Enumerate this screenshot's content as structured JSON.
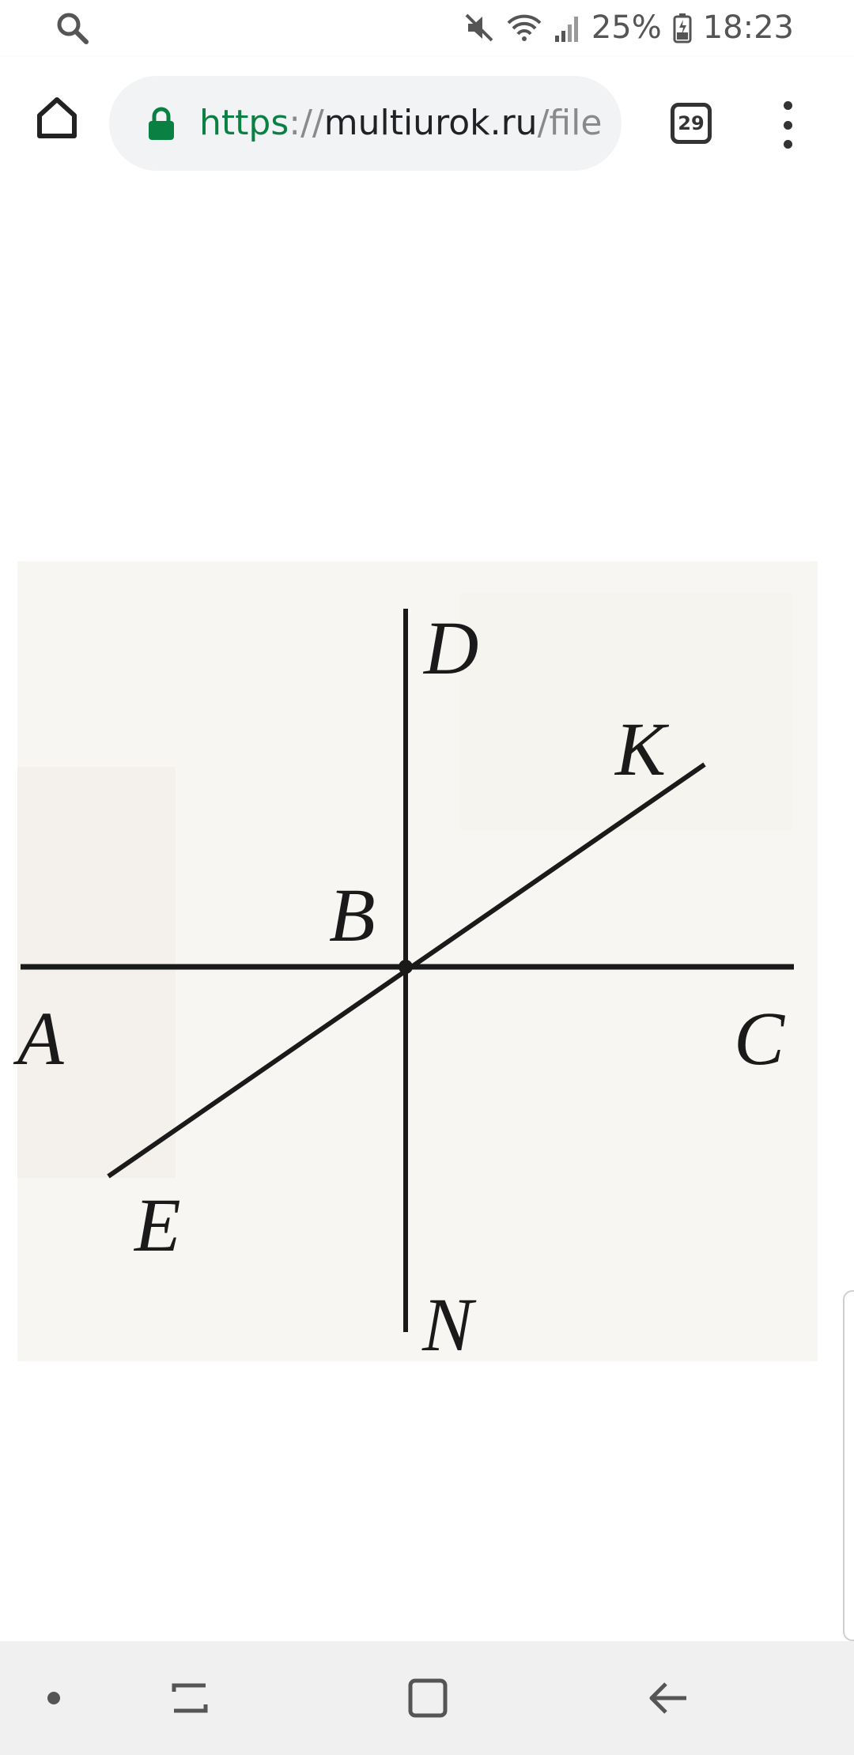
{
  "status_bar": {
    "left_icon": "search-icon",
    "battery_percent": "25%",
    "time": "18:23",
    "icons": [
      "mute-icon",
      "wifi-icon",
      "signal-icon",
      "battery-icon"
    ]
  },
  "toolbar": {
    "home_icon": "home-icon",
    "url": {
      "scheme": "https",
      "separator": "://",
      "host": "multiurok.ru",
      "path": "/file"
    },
    "tab_count": "29",
    "menu_icon": "more-vert-icon"
  },
  "figure": {
    "labels": {
      "A": "A",
      "B": "B",
      "C": "C",
      "D": "D",
      "E": "E",
      "K": "K",
      "N": "N"
    }
  },
  "navbar": {
    "icons": [
      "dot-icon",
      "recents-icon",
      "home-square-icon",
      "back-icon"
    ]
  },
  "colors": {
    "url_scheme": "#0b8043",
    "figure_background": "#f7f6f2",
    "line": "#1a1a1a"
  }
}
